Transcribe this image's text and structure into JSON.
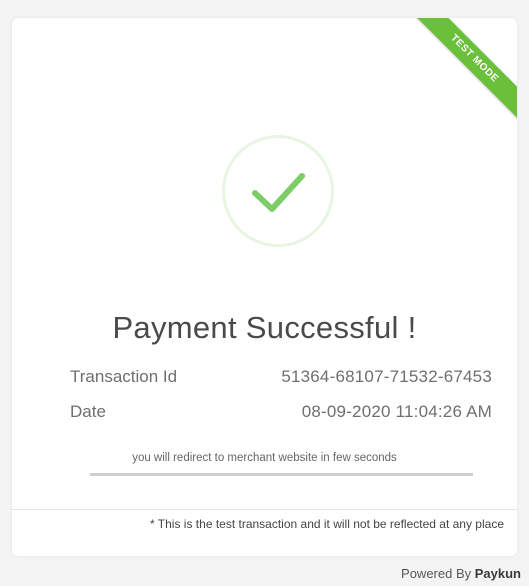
{
  "badge": {
    "label": "TEST MODE",
    "color": "#6abf3b"
  },
  "status": {
    "icon": "checkmark-icon",
    "title": "Payment Successful !"
  },
  "details": [
    {
      "label": "Transaction Id",
      "value": "51364-68107-71532-67453"
    },
    {
      "label": "Date",
      "value": "08-09-2020 11:04:26 AM"
    }
  ],
  "redirect": {
    "message": "you will redirect to merchant website in few seconds",
    "progress": 0
  },
  "note": "* This is the test transaction and it will not be reflected at any place",
  "footer": {
    "prefix": "Powered By",
    "brand": "Paykun"
  }
}
